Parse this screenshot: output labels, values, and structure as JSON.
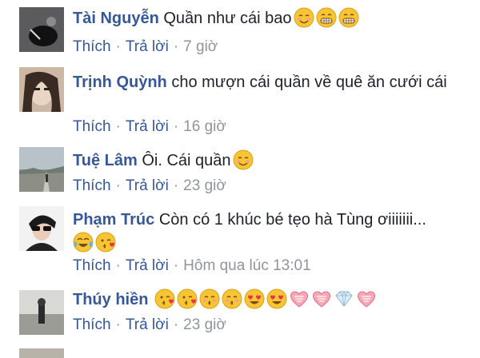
{
  "comments": [
    {
      "name": "Tài Nguyễn",
      "text": "Quần như cái bao",
      "emojis": [
        "smiling-face-icon",
        "grinning-face-icon",
        "grinning-face-icon"
      ],
      "like": "Thích",
      "reply": "Trả lời",
      "time": "7 giờ"
    },
    {
      "name": "Trịnh Quỳnh",
      "text": "cho mượn cái quần về quê ăn cưới cái",
      "emojis": [],
      "like": "Thích",
      "reply": "Trả lời",
      "time": "16 giờ"
    },
    {
      "name": "Tuệ Lâm",
      "text": "Ôi. Cái quần",
      "emojis": [
        "smiling-face-icon"
      ],
      "like": "Thích",
      "reply": "Trả lời",
      "time": "23 giờ"
    },
    {
      "name": "Phạm Trúc",
      "text": "Còn có 1 khúc bé tẹo hà Tùng ơiiiiiii...",
      "emojis": [
        "tears-of-joy-icon",
        "kissing-heart-icon"
      ],
      "like": "Thích",
      "reply": "Trả lời",
      "time": "Hôm qua lúc 13:01"
    },
    {
      "name": "Thúy hiền",
      "text": "",
      "emojis": [
        "kissing-heart-icon",
        "kissing-heart-icon",
        "kissing-face-icon",
        "kissing-face-icon",
        "heart-eyes-icon",
        "heart-eyes-icon",
        "pink-heart-icon",
        "pink-heart-icon",
        "diamond-icon",
        "pink-heart-icon"
      ],
      "like": "Thích",
      "reply": "Trả lời",
      "time": "23 giờ"
    }
  ],
  "colors": {
    "name": "#365899",
    "text": "#1d2129",
    "meta": "#90949c",
    "emoji_yellow": "#f7c434"
  }
}
